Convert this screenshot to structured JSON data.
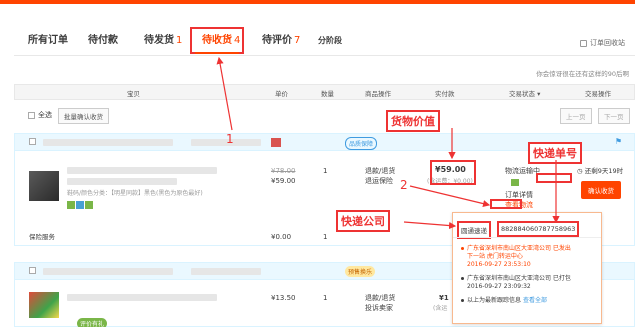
{
  "tabs": {
    "all": "所有订单",
    "unpaid": "待付款",
    "to_ship": "待发货",
    "to_ship_count": "1",
    "to_receive": "待收货",
    "to_receive_count": "4",
    "to_review": "待评价",
    "to_review_count": "7",
    "installment": "分阶段",
    "recycle_bin": "订单回收站"
  },
  "hint": "你会惊讶很在还有这样的90后啊",
  "table_headers": {
    "item": "宝贝",
    "unit_price": "单价",
    "quantity": "数量",
    "item_ops": "商品操作",
    "paid": "实付款",
    "trade_status": "交易状态",
    "trade_ops": "交易操作"
  },
  "toolbar": {
    "select_all": "全选",
    "batch_confirm": "批量确认收货",
    "prev": "上一页",
    "next": "下一页"
  },
  "order1": {
    "badge": "品质保障",
    "original_price": "¥78.00",
    "price": "¥59.00",
    "qty": "1",
    "refund": "退款/退货",
    "return_guarantee": "退运保险",
    "paid_amount": "¥59.00",
    "paid_note": "(含运费：¥0.00)",
    "status_shipping": "物流运输中",
    "order_detail": "订单详情",
    "view_logistics": "查看物流",
    "auto_confirm": "还剩9天19时",
    "confirm_btn": "确认收货",
    "item_sku": "鞋码/颜色分类：【明星同款】黑色(黑色为原色最好)",
    "insurance_label": "保险服务",
    "insurance_price": "¥0.00",
    "insurance_qty": "1"
  },
  "order2": {
    "badge": "预售换乐",
    "price": "¥13.50",
    "qty": "1",
    "refund": "退款/退货",
    "complaint": "投诉卖家",
    "paid_partial": "¥1",
    "paid_note": "(含运",
    "extra_label": "评价有礼"
  },
  "popup": {
    "carrier": "圆通速递",
    "tracking_no": "882884060787758963",
    "events": [
      {
        "text": "广东省深圳市南山区大亚湾公司 已发出",
        "text2": "下一站 虎门转运中心",
        "time": "2016-09-27 23:53:10"
      },
      {
        "text": "广东省深圳市南山区大亚湾公司 已打包",
        "time": "2016-09-27 23:09:32"
      },
      {
        "text": "以上为最新跟踪信息",
        "link": "查看全部"
      }
    ]
  },
  "annotations": {
    "cargo_value": "货物价值",
    "tracking_no": "快递单号",
    "courier": "快递公司",
    "num1": "1",
    "num2": "2"
  },
  "colors": {
    "accent": "#ff4400",
    "annotation_red": "#ee3333",
    "order_header_bg": "#eaf8ff"
  }
}
